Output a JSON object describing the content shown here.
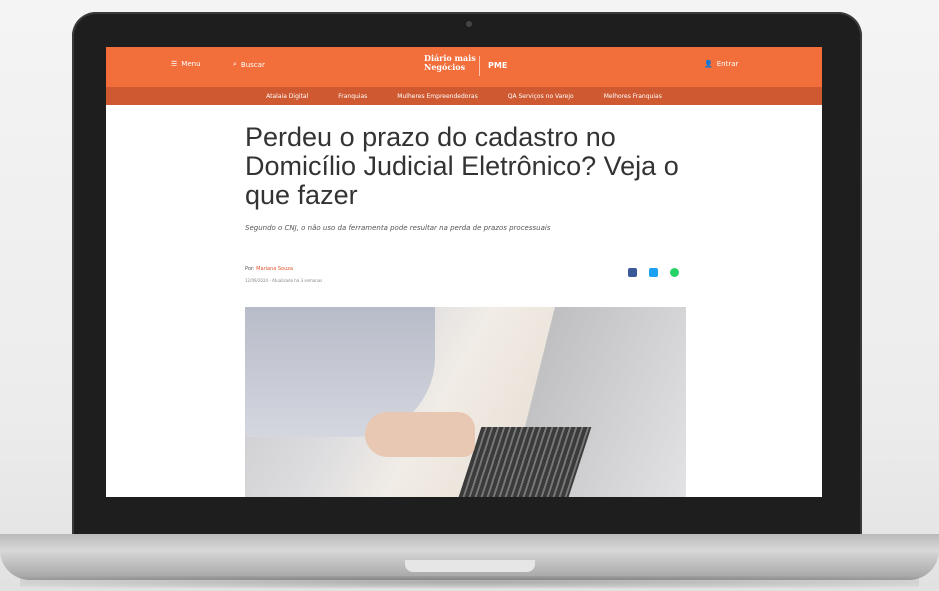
{
  "header": {
    "menu_label": "Menu",
    "search_label": "Buscar",
    "logo_line1": "Diário mais",
    "logo_line2": "Negócios",
    "pme_label": "PME",
    "login_label": "Entrar",
    "accent_color": "#f26e3b"
  },
  "subnav": {
    "items": [
      "Atalaia Digital",
      "Franquias",
      "Mulheres Empreendedoras",
      "QA Serviços no Varejo",
      "Melhores Franquias"
    ]
  },
  "article": {
    "headline": "Perdeu o prazo do cadastro no Domicílio Judicial Eletrônico? Veja o que fazer",
    "subtitle": "Segundo o CNJ, o não uso da ferramenta pode resultar na perda de prazos processuais",
    "byline_prefix": "Por:",
    "author": "Mariana Souza",
    "dateline": "12/09/2024 - Atualizado há 3 semanas"
  },
  "share": {
    "icons": [
      "facebook-icon",
      "twitter-icon",
      "whatsapp-icon"
    ],
    "colors": [
      "#3b5998",
      "#1da1f2",
      "#25d366"
    ]
  }
}
